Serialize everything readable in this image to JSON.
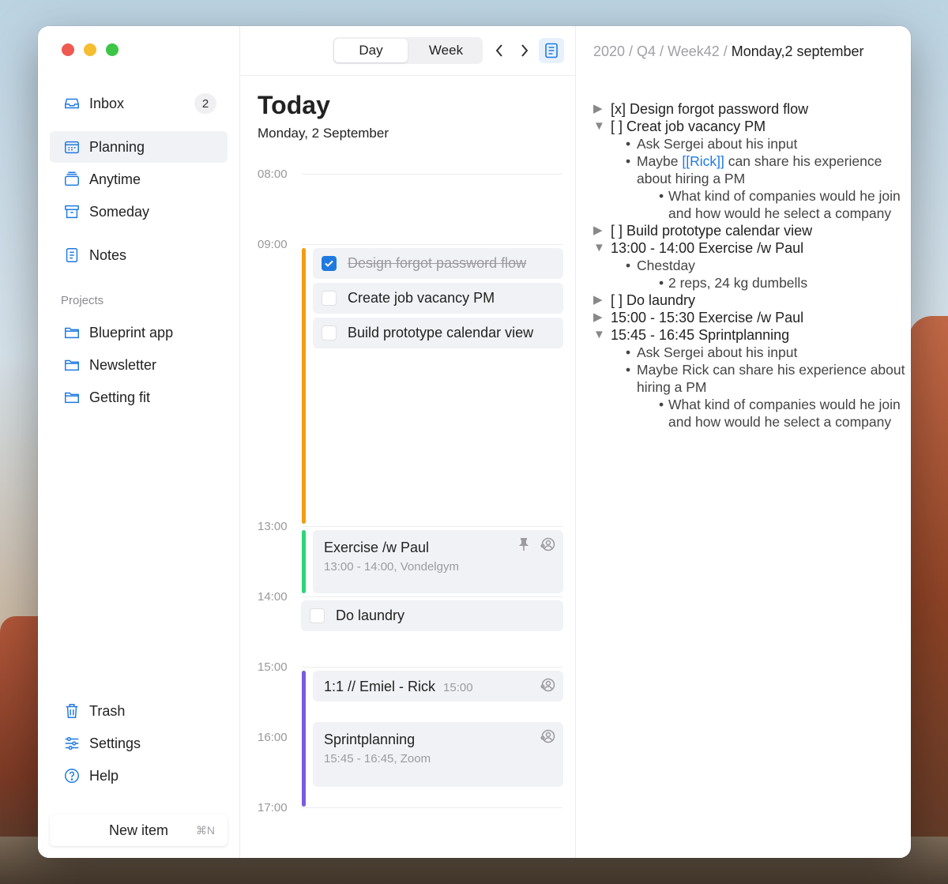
{
  "sidebar": {
    "inbox": {
      "label": "Inbox",
      "count": "2"
    },
    "items": [
      {
        "label": "Planning"
      },
      {
        "label": "Anytime"
      },
      {
        "label": "Someday"
      },
      {
        "label": "Notes"
      }
    ],
    "projects_label": "Projects",
    "projects": [
      {
        "label": "Blueprint app"
      },
      {
        "label": "Newsletter"
      },
      {
        "label": "Getting fit"
      }
    ],
    "footer_items": [
      {
        "label": "Trash"
      },
      {
        "label": "Settings"
      },
      {
        "label": "Help"
      }
    ],
    "new_item": {
      "label": "New item",
      "shortcut": "⌘N"
    }
  },
  "toolbar": {
    "day_label": "Day",
    "week_label": "Week",
    "prev": "‹",
    "next": "›"
  },
  "day": {
    "title": "Today",
    "date": "Monday, 2 September",
    "hours": [
      "08:00",
      "09:00",
      "13:00",
      "14:00",
      "15:00",
      "16:00",
      "17:00"
    ],
    "tasks": [
      {
        "label": "Design forgot password flow",
        "done": true
      },
      {
        "label": "Create job vacancy PM",
        "done": false
      },
      {
        "label": "Build prototype calendar view",
        "done": false
      }
    ],
    "exercise": {
      "title": "Exercise /w Paul",
      "sub": "13:00 - 14:00, Vondelgym"
    },
    "laundry": {
      "label": "Do laundry"
    },
    "one_on_one": {
      "title": "1:1 // Emiel - Rick",
      "time": "15:00"
    },
    "sprint": {
      "title": "Sprintplanning",
      "sub": "15:45 - 16:45, Zoom"
    },
    "colors": {
      "morning": "#f39c12",
      "exercise": "#2ed47a",
      "afternoon": "#7a5be0"
    }
  },
  "notes": {
    "crumb_path": "2020 / Q4 / Week42 / ",
    "crumb_current": "Monday,2 september",
    "lines": [
      {
        "level": 0,
        "tri": "▶",
        "text": "[x] Design forgot password flow"
      },
      {
        "level": 0,
        "tri": "▼",
        "text": "[ ] Creat job vacancy PM"
      },
      {
        "level": 1,
        "text": "Ask Sergei about his input"
      },
      {
        "level": 1,
        "pre": "Maybe ",
        "link": "[[Rick]]",
        "post": " can share his experience about hiring a PM"
      },
      {
        "level": 2,
        "text": "What kind of companies would he join and how would he select a company"
      },
      {
        "level": 0,
        "tri": "▶",
        "text": "[ ] Build prototype calendar view"
      },
      {
        "level": 0,
        "tri": "▼",
        "text": "13:00 - 14:00 Exercise /w Paul"
      },
      {
        "level": 1,
        "text": "Chestday"
      },
      {
        "level": 2,
        "text": "2 reps, 24 kg dumbells"
      },
      {
        "level": 0,
        "tri": "▶",
        "text": "[ ] Do laundry"
      },
      {
        "level": 0,
        "tri": "▶",
        "text": "15:00 - 15:30 Exercise /w Paul"
      },
      {
        "level": 0,
        "tri": "▼",
        "text": "15:45 - 16:45 Sprintplanning"
      },
      {
        "level": 1,
        "text": "Ask Sergei about his input"
      },
      {
        "level": 1,
        "text": "Maybe Rick can share his experience about hiring a PM"
      },
      {
        "level": 2,
        "text": "What kind of companies would he join and how would he select a company"
      }
    ]
  }
}
